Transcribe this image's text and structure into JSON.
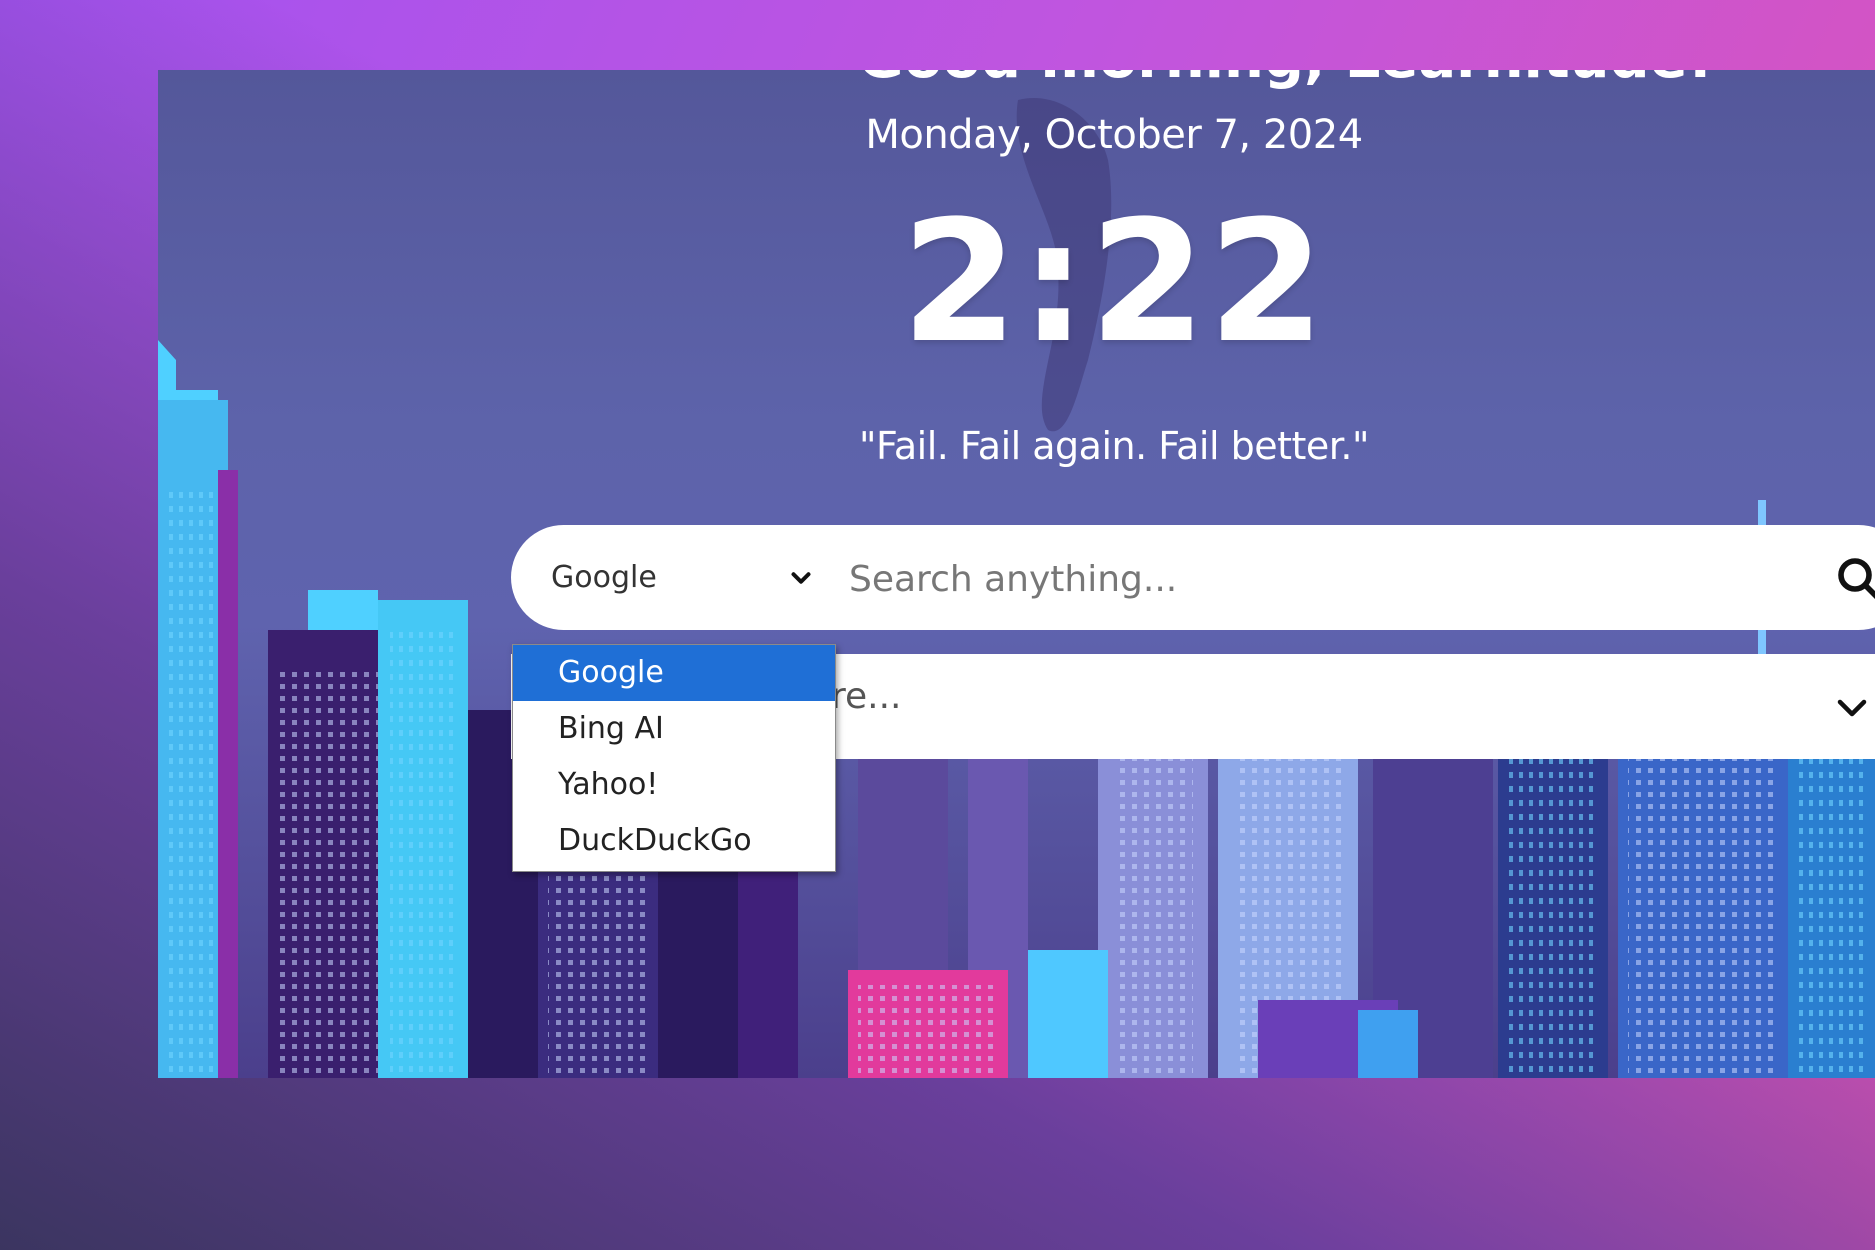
{
  "greeting": "Good morning, Learnitude!",
  "date": "Monday, October 7, 2024",
  "time": "2:22",
  "quote": "\"Fail. Fail again. Fail better.\"",
  "search": {
    "engine_selected": "Google",
    "placeholder": "Search anything...",
    "engines": [
      "Google",
      "Bing AI",
      "Yahoo!",
      "DuckDuckGo"
    ]
  },
  "second_field": {
    "visible_text": "re..."
  },
  "colors": {
    "selected_option": "#1f6fd6",
    "background_gradient_start": "#a352f0",
    "background_gradient_end": "#e054b2"
  }
}
